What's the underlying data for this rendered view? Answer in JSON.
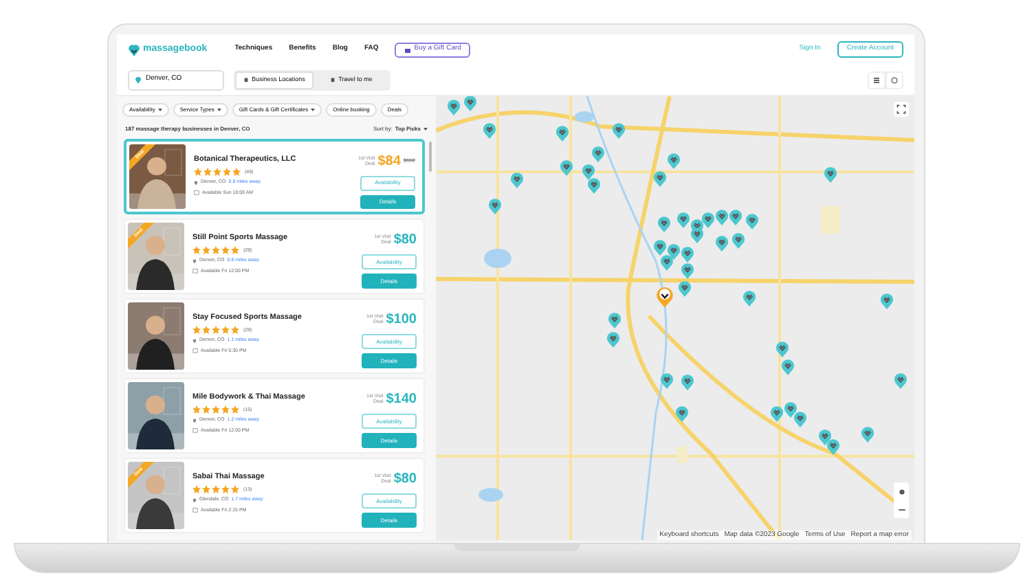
{
  "nav": {
    "logo": "massagebook",
    "links": [
      "Techniques",
      "Benefits",
      "Blog",
      "FAQ"
    ],
    "gift_button": "Buy a Gift Card",
    "sign_in": "Sign In",
    "create_account": "Create Account"
  },
  "search": {
    "location": "Denver, CO",
    "modes": [
      {
        "label": "Business Locations",
        "selected": true
      },
      {
        "label": "Travel to me",
        "selected": false
      }
    ]
  },
  "filters": [
    {
      "label": "Availability",
      "dropdown": true
    },
    {
      "label": "Service Types",
      "dropdown": true
    },
    {
      "label": "Gift Cards & Gift Certificates",
      "dropdown": true
    },
    {
      "label": "Online booking",
      "dropdown": false
    },
    {
      "label": "Deals",
      "dropdown": false
    }
  ],
  "results": {
    "summary": "187 massage therapy businesses in Denver, CO",
    "sort_label": "Sort by:",
    "sort_value": "Top Picks"
  },
  "listings": [
    {
      "name": "Botanical Therapeutics, LLC",
      "stars": 5,
      "reviews": "(49)",
      "location": "Denver, CO",
      "distance": "0.8 miles away",
      "availability": "Available Sun 10:00 AM",
      "deal_label": "1st Visit Deal",
      "price": "$84",
      "old_price": "$112",
      "badge": "Deal",
      "selected": true,
      "availability_button": "Availability",
      "details_button": "Details"
    },
    {
      "name": "Still Point Sports Massage",
      "stars": 5,
      "reviews": "(29)",
      "location": "Denver, CO",
      "distance": "0.8 miles away",
      "availability": "Available Fri 12:00 PM",
      "deal_label": "1st Visit Deal",
      "price": "$80",
      "badge": "Deal",
      "selected": false,
      "availability_button": "Availability",
      "details_button": "Details"
    },
    {
      "name": "Stay Focused Sports Massage",
      "stars": 5,
      "reviews": "(29)",
      "location": "Denver, CO",
      "distance": "1.1 miles away",
      "availability": "Available Fri 5:30 PM",
      "deal_label": "1st Visit Deal",
      "price": "$100",
      "selected": false,
      "availability_button": "Availability",
      "details_button": "Details"
    },
    {
      "name": "Mile Bodywork & Thai Massage",
      "stars": 5,
      "reviews": "(15)",
      "location": "Denver, CO",
      "distance": "1.2 miles away",
      "availability": "Available Fri 12:00 PM",
      "deal_label": "1st Visit Deal",
      "price": "$140",
      "selected": false,
      "availability_button": "Availability",
      "details_button": "Details"
    },
    {
      "name": "Sabai Thai Massage",
      "stars": 5,
      "reviews": "(13)",
      "location": "Glendale, CO",
      "distance": "1.7 miles away",
      "availability": "Available Fri 2:15 PM",
      "deal_label": "1st Visit Deal",
      "price": "$80",
      "badge": "Deal",
      "selected": false,
      "availability_button": "Availability",
      "details_button": "Details"
    }
  ],
  "map": {
    "kind": "picture",
    "footer": [
      "Keyboard shortcuts",
      "Map data ©2023 Google",
      "Terms of Use",
      "Report a map error"
    ]
  }
}
